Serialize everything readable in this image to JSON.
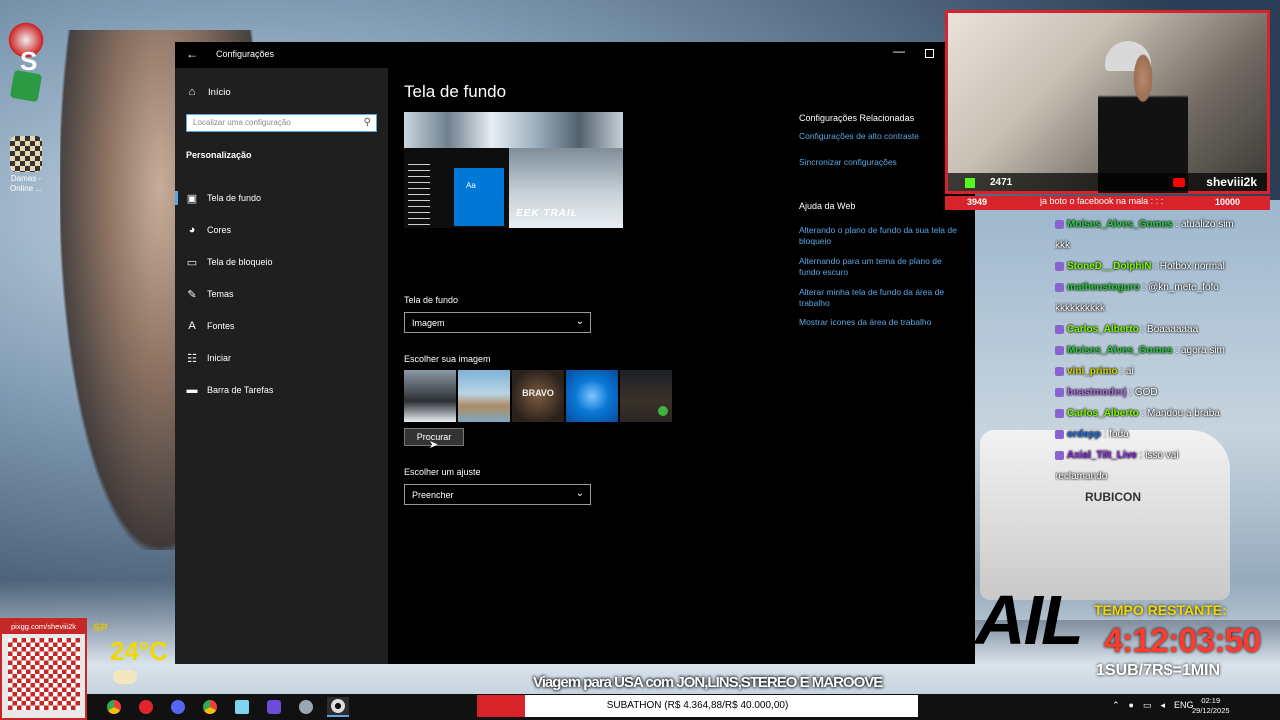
{
  "window": {
    "title": "Configurações",
    "back_icon": "back-arrow-icon"
  },
  "sidebar": {
    "home": "Início",
    "search_placeholder": "Localizar uma configuração",
    "section": "Personalização",
    "items": [
      {
        "label": "Tela de fundo",
        "icon": "picture-icon",
        "active": true
      },
      {
        "label": "Cores",
        "icon": "palette-icon",
        "active": false
      },
      {
        "label": "Tela de bloqueio",
        "icon": "lockscreen-icon",
        "active": false
      },
      {
        "label": "Temas",
        "icon": "brush-icon",
        "active": false
      },
      {
        "label": "Fontes",
        "icon": "font-icon",
        "active": false
      },
      {
        "label": "Iniciar",
        "icon": "start-icon",
        "active": false
      },
      {
        "label": "Barra de Tarefas",
        "icon": "taskbar-icon",
        "active": false
      }
    ]
  },
  "main": {
    "title": "Tela de fundo",
    "preview_trail": "EEK TRAIL",
    "preview_tile": "Aa",
    "background_label": "Tela de fundo",
    "background_value": "Imagem",
    "choose_image_label": "Escolher sua imagem",
    "thumb3_text": "BRAVO",
    "browse_button": "Procurar",
    "fit_label": "Escolher um ajuste",
    "fit_value": "Preencher"
  },
  "related": {
    "heading": "Configurações Relacionadas",
    "links": [
      "Configurações de alto contraste",
      "Sincronizar configurações"
    ],
    "help_heading": "Ajuda da Web",
    "help_links": [
      "Alterando o plano de fundo da sua tela de bloqueio",
      "Alternando para um tema de plano de fundo escuro",
      "Alterar minha tela de fundo da área de trabalho",
      "Mostrar ícones da área de trabalho"
    ]
  },
  "desktop": {
    "icon_label": "Damas - Online ...",
    "jeep_word": "RUBICON",
    "big_trail": "AIL"
  },
  "overlay": {
    "cam_count": "2471",
    "cam_name": "sheviii2k",
    "goal_left": "3949",
    "goal_mid": "ja boto o facebook na mala : : :",
    "goal_right": "10000",
    "pix_label": "pixgg.com/sheviii2k",
    "weather_city": "SP",
    "weather_temp": "24°C",
    "timer_heading": "TEMPO RESTANTE:",
    "timer_value": "4:12:03:50",
    "timer_sub": "1SUB/7R$=1MIN",
    "marquee": "Viagem para USA com JON,LINS,STEREO E MAROOVE"
  },
  "chat": [
    {
      "user": "Moises_Alves_Gomes",
      "color": "#2ecc40",
      "text": ": atualizo sim"
    },
    {
      "user": "",
      "color": "#ffffff",
      "text": "kkk"
    },
    {
      "user": "StoneD__DolphiN",
      "color": "#7CFC00",
      "text": ": Hotbox normal"
    },
    {
      "user": "matheustoguro",
      "color": "#2ecc40",
      "text": ": @kn_mete_fofo"
    },
    {
      "user": "",
      "color": "#ffffff",
      "text": "kkkkkkkkkk"
    },
    {
      "user": "Carlos_Alberto",
      "color": "#7CFC00",
      "text": ": Boaaaaaaa"
    },
    {
      "user": "Moises_Alves_Gomes",
      "color": "#2ecc40",
      "text": ": agora sim"
    },
    {
      "user": "vini_primo",
      "color": "#d4d400",
      "text": ": ai"
    },
    {
      "user": "beastmoderj",
      "color": "#b06be0",
      "text": ": GOD"
    },
    {
      "user": "Carlos_Alberto",
      "color": "#7CFC00",
      "text": ": Mandou a braba"
    },
    {
      "user": "ordepp",
      "color": "#1e6fd9",
      "text": ": foda"
    },
    {
      "user": "Axial_Tilt_Live",
      "color": "#8a2be2",
      "text": ": isso vai"
    },
    {
      "user": "",
      "color": "#ffffff",
      "text": "reclamando"
    }
  ],
  "taskbar": {
    "subathon": "SUBATHON (R$ 4.364,88/R$ 40.000,00)",
    "subathon_progress": 0.109,
    "lang": "ENG",
    "time": "02:19",
    "date": "29/12/2025"
  },
  "colors": {
    "accent": "#5aa7e6",
    "brand_red": "#d8232a",
    "timer_red": "#ff3b30",
    "timer_yellow": "#f1d800"
  }
}
